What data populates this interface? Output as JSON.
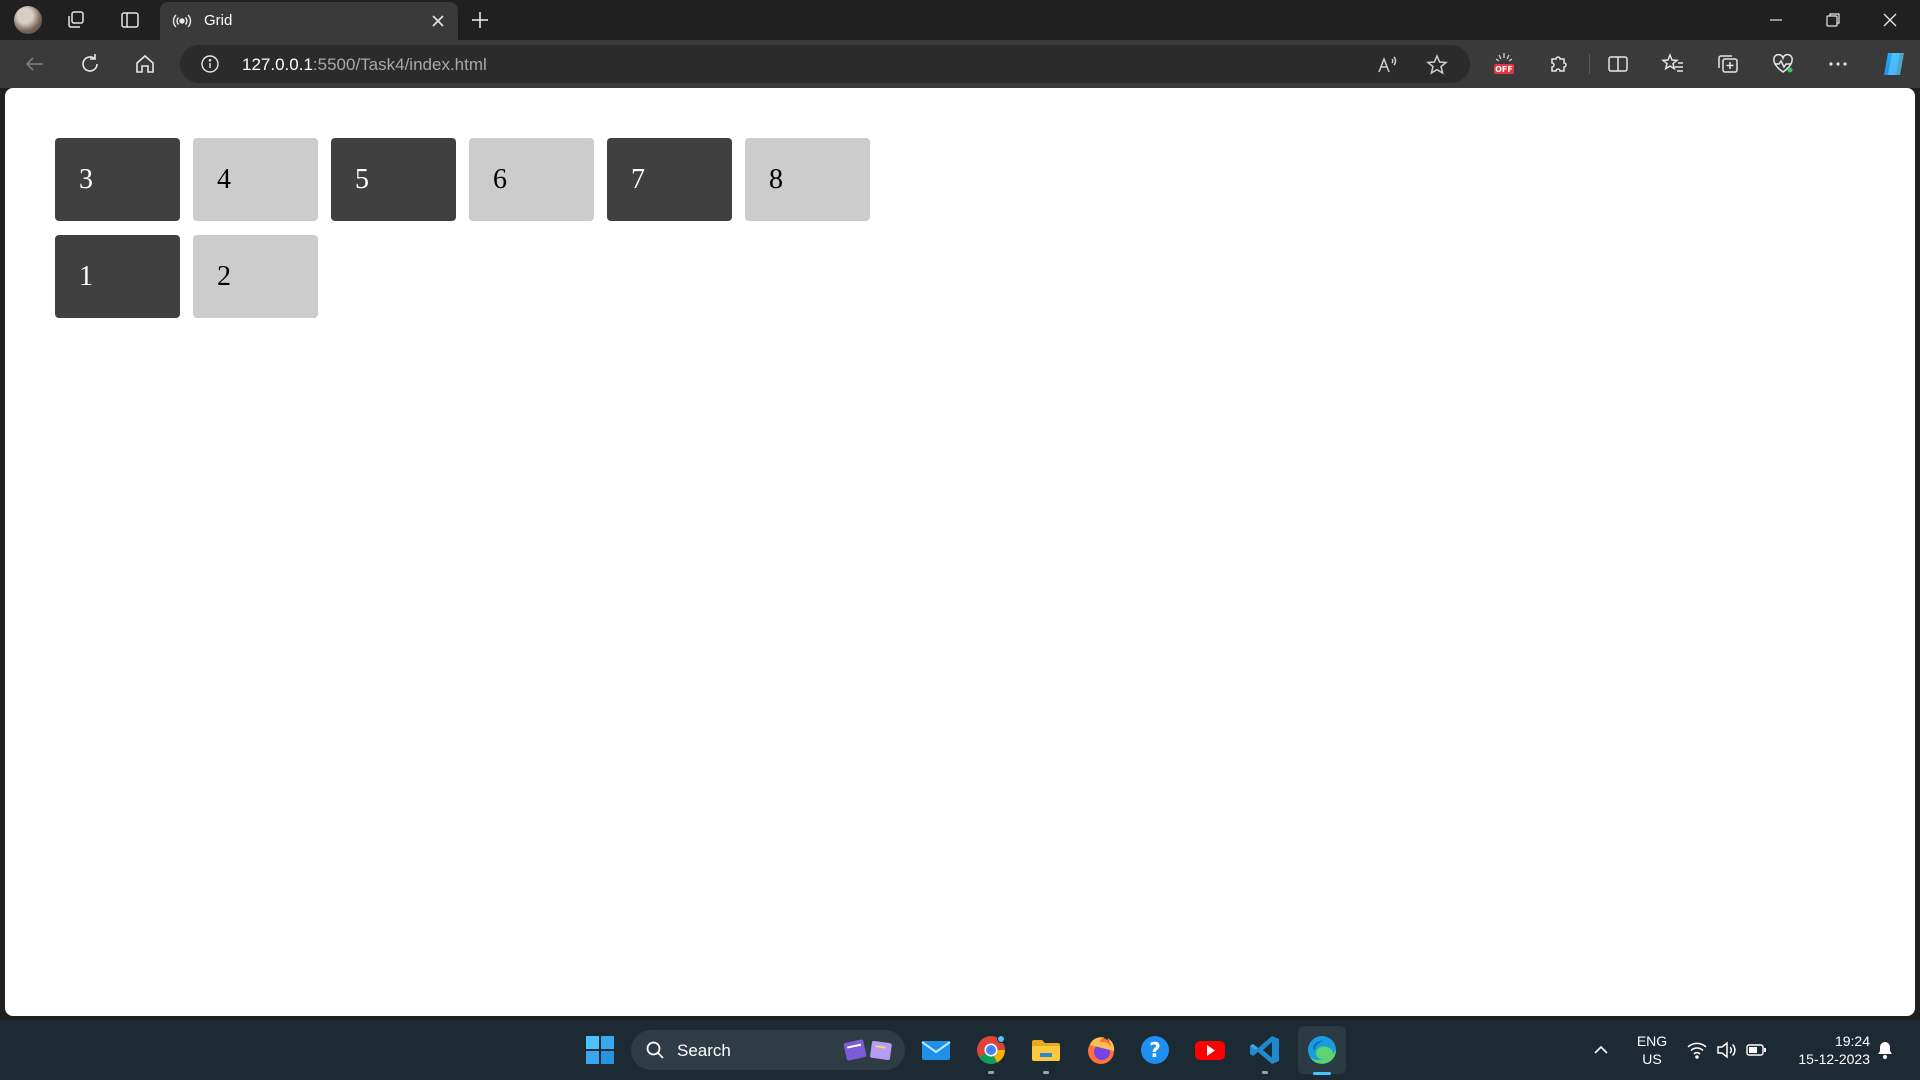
{
  "browser": {
    "tab": {
      "title": "Grid"
    },
    "address": {
      "host": "127.0.0.1",
      "rest": ":5500/Task4/index.html"
    }
  },
  "page": {
    "grid_items": [
      {
        "label": "3",
        "tone": "dark"
      },
      {
        "label": "4",
        "tone": "light"
      },
      {
        "label": "5",
        "tone": "dark"
      },
      {
        "label": "6",
        "tone": "light"
      },
      {
        "label": "7",
        "tone": "dark"
      },
      {
        "label": "8",
        "tone": "light"
      },
      {
        "label": "1",
        "tone": "dark"
      },
      {
        "label": "2",
        "tone": "light"
      }
    ]
  },
  "taskbar": {
    "search_label": "Search",
    "lang_line1": "ENG",
    "lang_line2": "US",
    "time": "19:24",
    "date": "15-12-2023"
  },
  "colors": {
    "dark_cell": "#404040",
    "light_cell": "#cccccc",
    "accent": "#4cc2ff"
  }
}
